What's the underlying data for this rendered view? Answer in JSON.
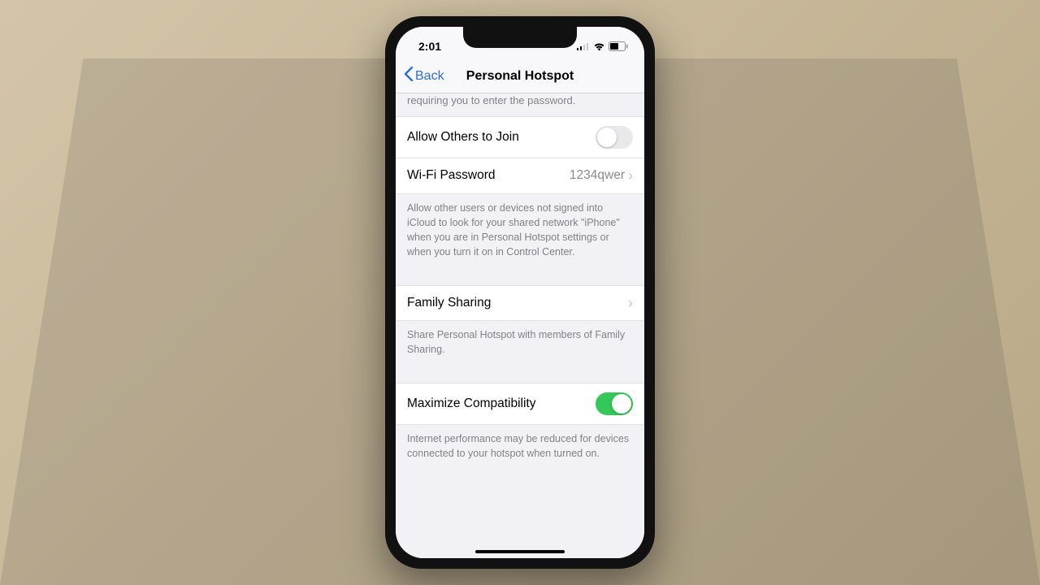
{
  "status": {
    "time": "2:01"
  },
  "nav": {
    "back_label": "Back",
    "title": "Personal Hotspot"
  },
  "truncated_header_text": "requiring you to enter the password.",
  "rows": {
    "allow_others": {
      "label": "Allow Others to Join",
      "on": false
    },
    "wifi_password": {
      "label": "Wi-Fi Password",
      "value": "1234qwer"
    },
    "allow_footer": "Allow other users or devices not signed into iCloud to look for your shared network \"iPhone\" when you are in Personal Hotspot settings or when you turn it on in Control Center.",
    "family_sharing": {
      "label": "Family Sharing"
    },
    "family_footer": "Share Personal Hotspot with members of Family Sharing.",
    "max_compat": {
      "label": "Maximize Compatibility",
      "on": true
    },
    "max_compat_footer": "Internet performance may be reduced for devices connected to your hotspot when turned on."
  }
}
